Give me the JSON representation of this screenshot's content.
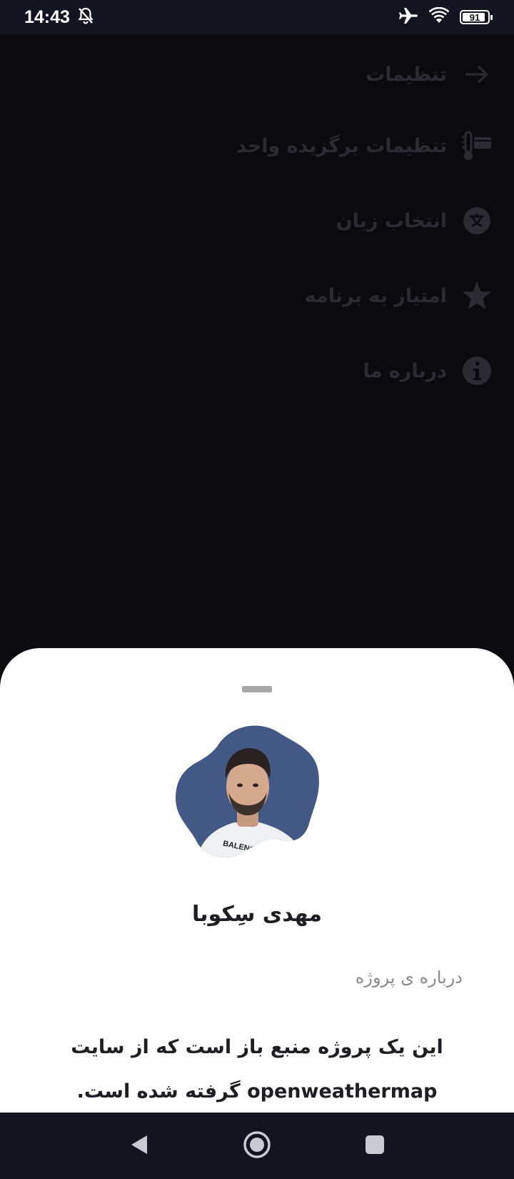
{
  "status_bar": {
    "time": "14:43",
    "battery": "91",
    "battery_level": 0.91,
    "icons": [
      "bell-off-icon",
      "airplane-icon",
      "wifi-icon",
      "battery-icon"
    ]
  },
  "settings": {
    "items": [
      {
        "label": "تنظیمات",
        "icon": "arrow-right-icon"
      },
      {
        "label": "تنظیمات برگزیده واحد",
        "icon": "thermometer-units-icon"
      },
      {
        "label": "انتخاب زبان",
        "icon": "translate-icon"
      },
      {
        "label": "امتیاز به برنامه",
        "icon": "star-icon"
      },
      {
        "label": "درباره ما",
        "icon": "info-icon"
      }
    ]
  },
  "about_sheet": {
    "developer_name": "مهدی سِکوبا",
    "section_label": "درباره ی پروژه",
    "description": "این یک پروژه منبع باز است که از سایت openweathermap گرفته شده است.",
    "avatar_shirt_text": "BALENCIAGA"
  },
  "nav_bar": {
    "buttons": [
      "back-icon",
      "home-icon",
      "recents-icon"
    ]
  },
  "colors": {
    "background": "#0a0a0f",
    "bars": "#121520",
    "dimmed_text": "#2b2b31",
    "avatar_blob": "#425885",
    "sheet": "#ffffff"
  }
}
